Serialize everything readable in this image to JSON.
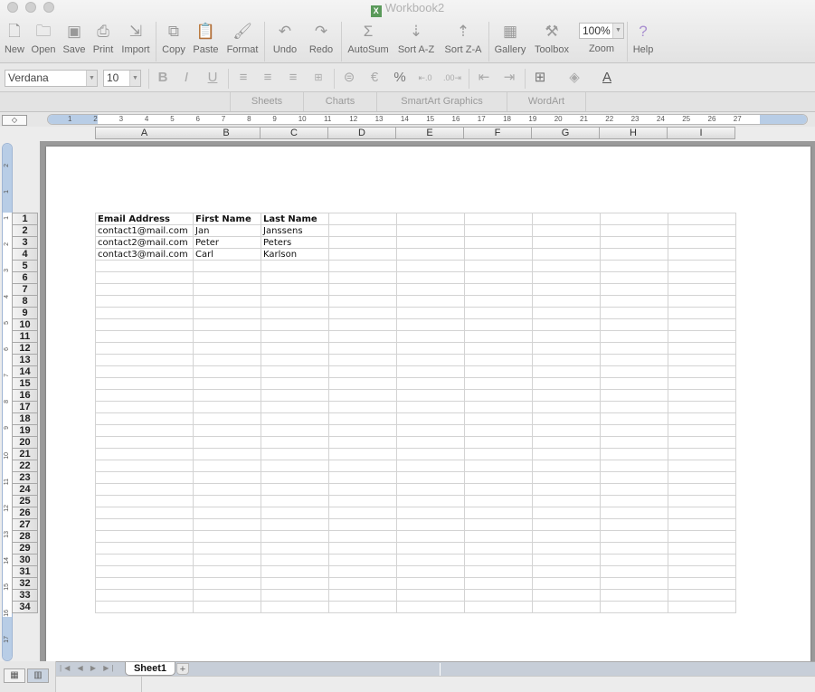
{
  "window": {
    "title": "Workbook2",
    "app_icon": "excel-icon"
  },
  "toolbar": {
    "items": [
      {
        "label": "New",
        "icon": "new-icon"
      },
      {
        "label": "Open",
        "icon": "open-icon"
      },
      {
        "label": "Save",
        "icon": "save-icon"
      },
      {
        "label": "Print",
        "icon": "print-icon"
      },
      {
        "label": "Import",
        "icon": "import-icon"
      },
      {
        "label": "Copy",
        "icon": "copy-icon"
      },
      {
        "label": "Paste",
        "icon": "paste-icon"
      },
      {
        "label": "Format",
        "icon": "format-brush-icon"
      },
      {
        "label": "Undo",
        "icon": "undo-icon"
      },
      {
        "label": "Redo",
        "icon": "redo-icon"
      },
      {
        "label": "AutoSum",
        "icon": "sigma-icon"
      },
      {
        "label": "Sort A-Z",
        "icon": "sort-az-icon"
      },
      {
        "label": "Sort Z-A",
        "icon": "sort-za-icon"
      },
      {
        "label": "Gallery",
        "icon": "gallery-icon"
      },
      {
        "label": "Toolbox",
        "icon": "toolbox-icon"
      },
      {
        "label": "Zoom",
        "value": "100%"
      },
      {
        "label": "Help",
        "icon": "help-icon"
      }
    ]
  },
  "format_bar": {
    "font": "Verdana",
    "size": "10"
  },
  "ribbon": {
    "tabs": [
      "Sheets",
      "Charts",
      "SmartArt Graphics",
      "WordArt"
    ]
  },
  "ruler": {
    "marks": [
      "1",
      "2",
      "3",
      "4",
      "5",
      "6",
      "7",
      "8",
      "9",
      "10",
      "11",
      "12",
      "13",
      "14",
      "15",
      "16",
      "17",
      "18",
      "19",
      "20",
      "21",
      "22",
      "23",
      "24",
      "25",
      "26",
      "27"
    ]
  },
  "vruler": {
    "marks": [
      "2",
      "1",
      "1",
      "2",
      "3",
      "4",
      "5",
      "6",
      "7",
      "8",
      "9",
      "10",
      "11",
      "12",
      "13",
      "14",
      "15",
      "16",
      "17"
    ]
  },
  "columns": [
    "A",
    "B",
    "C",
    "D",
    "E",
    "F",
    "G",
    "H",
    "I"
  ],
  "rows": [
    "1",
    "2",
    "3",
    "4",
    "5",
    "6",
    "7",
    "8",
    "9",
    "10",
    "11",
    "12",
    "13",
    "14",
    "15",
    "16",
    "17",
    "18",
    "19",
    "20",
    "21",
    "22",
    "23",
    "24",
    "25",
    "26",
    "27",
    "28",
    "29",
    "30",
    "31",
    "32",
    "33",
    "34"
  ],
  "cells": [
    [
      "Email Address",
      "First Name",
      "Last Name"
    ],
    [
      "contact1@mail.com",
      "Jan",
      "Janssens"
    ],
    [
      "contact2@mail.com",
      "Peter",
      "Peters"
    ],
    [
      "contact3@mail.com",
      "Carl",
      "Karlson"
    ]
  ],
  "sheet_tabs": [
    "Sheet1"
  ]
}
